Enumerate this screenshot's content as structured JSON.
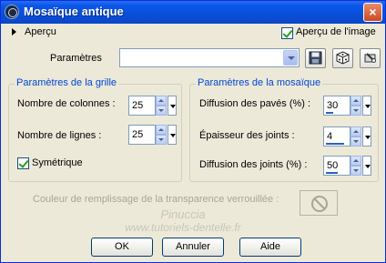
{
  "window": {
    "title": "Mosaïque antique",
    "close_glyph": "×"
  },
  "preview": {
    "label": "Aperçu",
    "image_preview_label": "Aperçu de l'image",
    "image_preview_checked": true
  },
  "presets": {
    "label": "Paramètres",
    "value": ""
  },
  "grid": {
    "title": "Paramètres de la grille",
    "columns": {
      "label": "Nombre de colonnes :",
      "value": "25"
    },
    "rows": {
      "label": "Nombre de lignes :",
      "value": "25"
    },
    "symmetric": {
      "label": "Symétrique",
      "checked": true
    }
  },
  "mosaic": {
    "title": "Paramètres de la mosaïque",
    "tile_diffusion": {
      "label": "Diffusion des pavés (%) :",
      "value": "30"
    },
    "joint_thickness": {
      "label": "Épaisseur des joints :",
      "value": "4"
    },
    "joint_diffusion": {
      "label": "Diffusion des joints (%) :",
      "value": "50"
    }
  },
  "transparency_fill": {
    "label": "Couleur de remplissage de la transparence verrouillée :",
    "icon": "no-symbol-icon"
  },
  "watermark": {
    "line1": "Pinuccia",
    "line2": "www.tutoriels-dentelle.fr"
  },
  "buttons": {
    "ok": "OK",
    "cancel": "Annuler",
    "help": "Aide"
  },
  "colors": {
    "title_bar": "#0a4ed8",
    "group_title": "#0046d5",
    "dialog_bg": "#ece9d8"
  }
}
